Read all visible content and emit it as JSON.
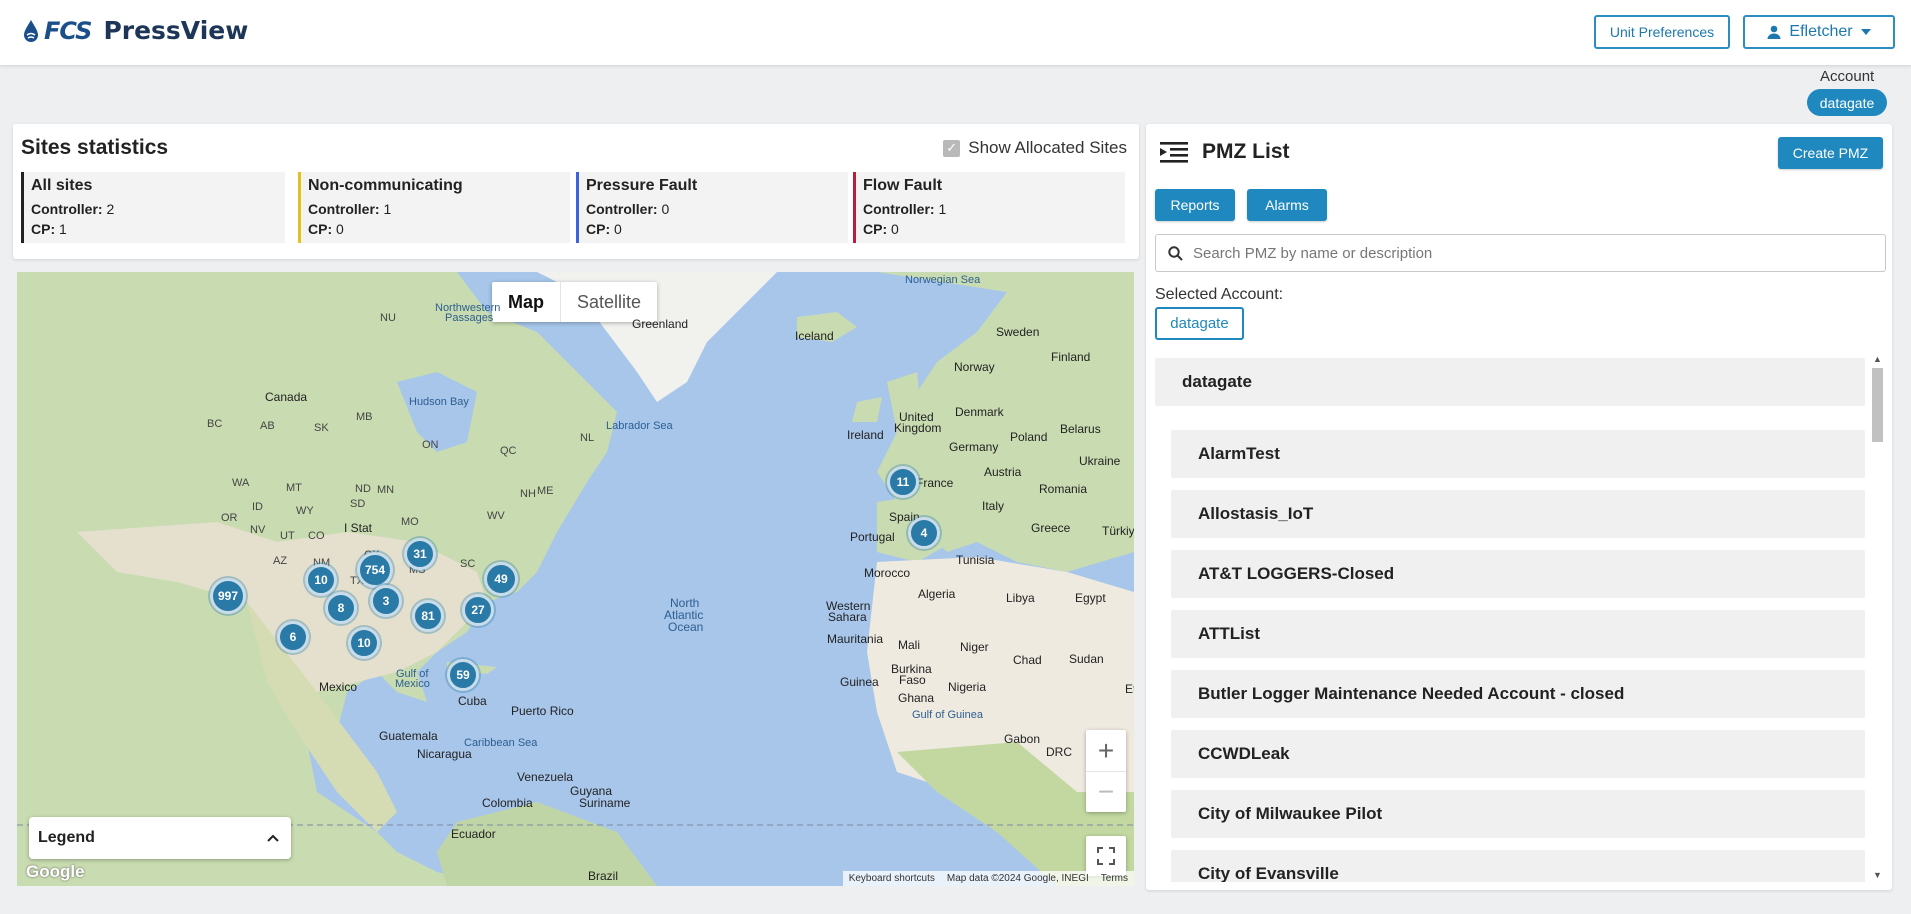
{
  "header": {
    "brand_fcs": "FCS",
    "brand_product": "PressView",
    "unit_preferences": "Unit Preferences",
    "user": "Efletcher"
  },
  "account": {
    "label": "Account",
    "name": "datagate"
  },
  "stats": {
    "title": "Sites statistics",
    "show_allocated": "Show Allocated Sites",
    "cards": [
      {
        "title": "All sites",
        "controller_label": "Controller:",
        "controller": "2",
        "cp_label": "CP:",
        "cp": "1",
        "color": "#222222"
      },
      {
        "title": "Non-communicating",
        "controller_label": "Controller:",
        "controller": "1",
        "cp_label": "CP:",
        "cp": "0",
        "color": "#e5c01a"
      },
      {
        "title": "Pressure Fault",
        "controller_label": "Controller:",
        "controller": "0",
        "cp_label": "CP:",
        "cp": "0",
        "color": "#3d63d8"
      },
      {
        "title": "Flow Fault",
        "controller_label": "Controller:",
        "controller": "1",
        "cp_label": "CP:",
        "cp": "0",
        "color": "#b81d3a"
      }
    ]
  },
  "map": {
    "type_map": "Map",
    "type_satellite": "Satellite",
    "legend": "Legend",
    "google": "Google",
    "attribution": [
      "Keyboard shortcuts",
      "Map data ©2024 Google, INEGI",
      "Terms"
    ],
    "labels": {
      "canada": "Canada",
      "hudson": "Hudson Bay",
      "greenland": "Greenland",
      "iceland": "Iceland",
      "labrador": "Labrador Sea",
      "norwegian": "Norwegian Sea",
      "nw_passages_1": "Northwestern",
      "nw_passages_2": "Passages",
      "sweden": "Sweden",
      "finland": "Finland",
      "norway": "Norway",
      "uk_1": "United",
      "uk_2": "Kingdom",
      "ireland": "Ireland",
      "denmark": "Denmark",
      "belarus": "Belarus",
      "poland": "Poland",
      "germany": "Germany",
      "ukraine": "Ukraine",
      "france": "France",
      "austria": "Austria",
      "romania": "Romania",
      "italy": "Italy",
      "spain": "Spain",
      "portugal": "Portugal",
      "greece": "Greece",
      "turkiye": "Türkiy",
      "tunisia": "Tunisia",
      "morocco": "Morocco",
      "algeria": "Algeria",
      "libya": "Libya",
      "egypt": "Egypt",
      "wsahara_1": "Western",
      "wsahara_2": "Sahara",
      "mauritania": "Mauritania",
      "mali": "Mali",
      "niger": "Niger",
      "chad": "Chad",
      "sudan": "Sudan",
      "burkina_1": "Burkina",
      "burkina_2": "Faso",
      "guinea": "Guinea",
      "nigeria": "Nigeria",
      "ghana": "Ghana",
      "gulf_guinea": "Gulf of Guinea",
      "gabon": "Gabon",
      "drc": "DRC",
      "et": "Et",
      "atlantic_1": "North",
      "atlantic_2": "Atlantic",
      "atlantic_3": "Ocean",
      "mexico": "Mexico",
      "gulf_mex_1": "Gulf of",
      "gulf_mex_2": "Mexico",
      "cuba": "Cuba",
      "puerto": "Puerto Rico",
      "guatemala": "Guatemala",
      "caribbean": "Caribbean Sea",
      "nicaragua": "Nicaragua",
      "venezuela": "Venezuela",
      "guyana": "Guyana",
      "suriname": "Suriname",
      "colombia": "Colombia",
      "ecuador": "Ecuador",
      "brazil": "Brazil",
      "nu": "NU",
      "bc": "BC",
      "ab": "AB",
      "sk": "SK",
      "mb": "MB",
      "on": "ON",
      "qc": "QC",
      "nl": "NL",
      "wa": "WA",
      "mt": "MT",
      "nd": "ND",
      "mn": "MN",
      "id": "ID",
      "or": "OR",
      "wy": "WY",
      "sd": "SD",
      "nv": "NV",
      "ut": "UT",
      "co": "CO",
      "az": "AZ",
      "nm": "NM",
      "ok": "OK",
      "tx": "TX",
      "ms": "MS",
      "wv": "WV",
      "nh": "NH",
      "me": "ME",
      "sc": "SC",
      "mo": "MO",
      "states": "I Stat"
    },
    "clusters": [
      "997",
      "754",
      "31",
      "10",
      "8",
      "3",
      "49",
      "27",
      "6",
      "10",
      "81",
      "59",
      "11",
      "4"
    ]
  },
  "pmz": {
    "title": "PMZ List",
    "create": "Create PMZ",
    "reports": "Reports",
    "alarms": "Alarms",
    "search_placeholder": "Search PMZ by name or description",
    "selected_label": "Selected Account:",
    "selected_account": "datagate",
    "group": "datagate",
    "items": [
      "AlarmTest",
      "Allostasis_IoT",
      "AT&T LOGGERS-Closed",
      "ATTList",
      "Butler Logger Maintenance Needed Account - closed",
      "CCWDLeak",
      "City of Milwaukee Pilot",
      "City of Evansville"
    ]
  }
}
